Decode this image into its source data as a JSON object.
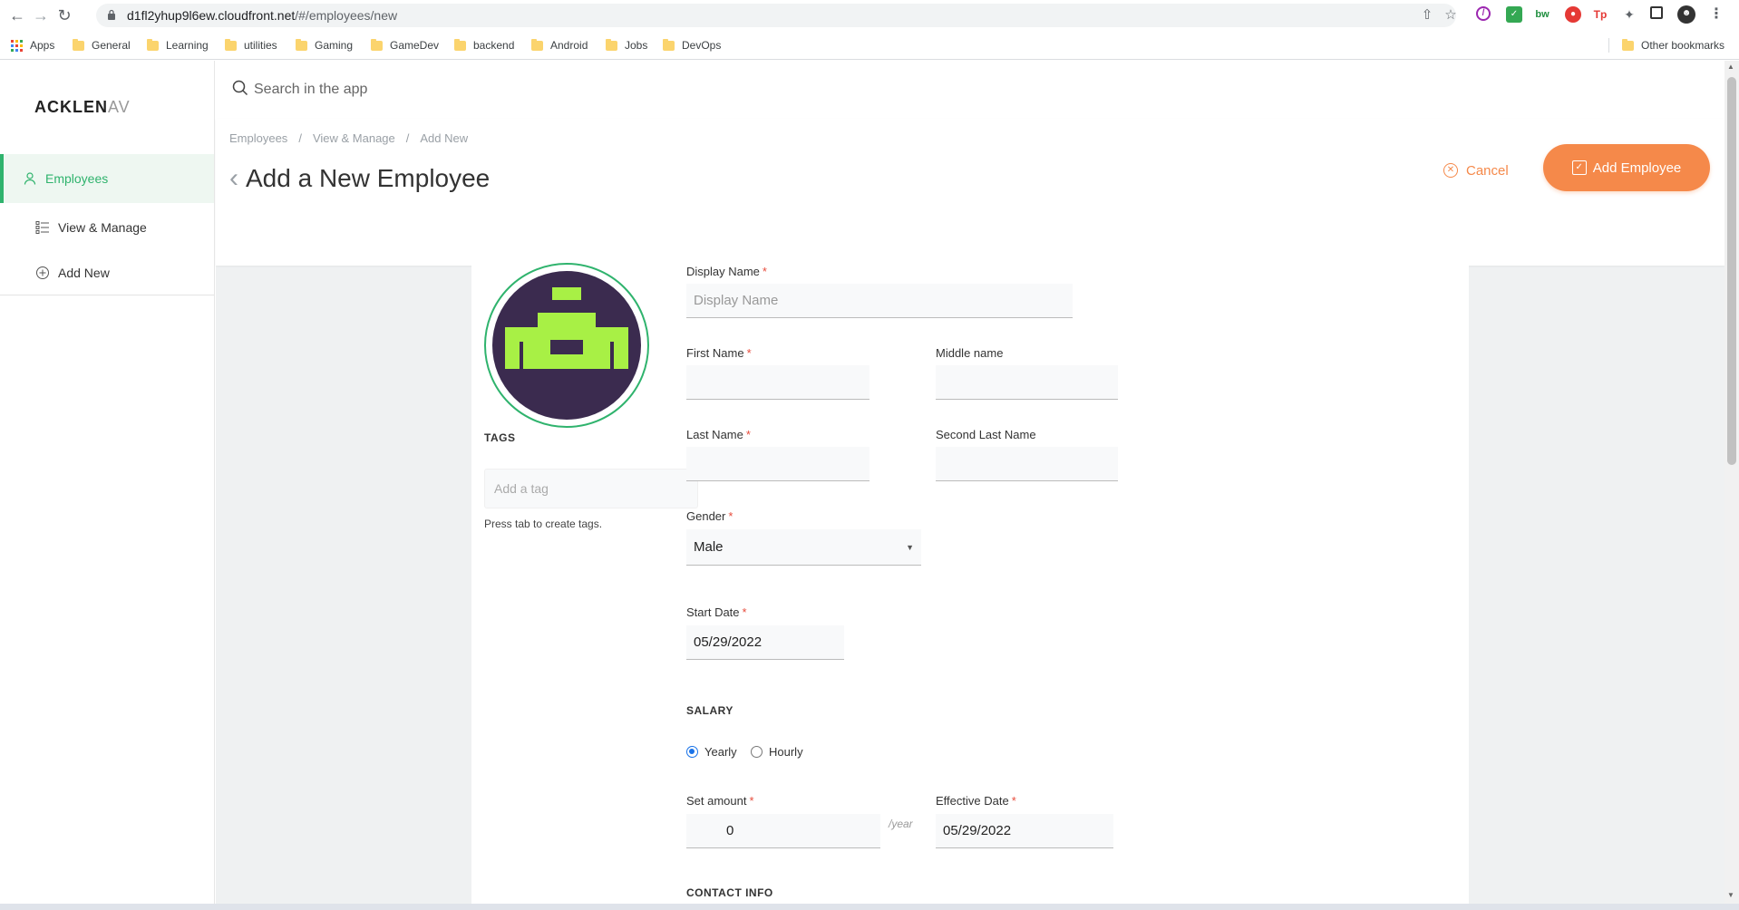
{
  "browser": {
    "url_host": "d1fl2yhup9l6ew.cloudfront.net",
    "url_path": "/#/employees/new",
    "bookmarks": [
      "Apps",
      "General",
      "Learning",
      "utilities",
      "Gaming",
      "GameDev",
      "backend",
      "Android",
      "Jobs",
      "DevOps"
    ],
    "other_bookmarks": "Other bookmarks"
  },
  "app": {
    "logo_main": "ACKLEN",
    "logo_fade": "AV",
    "search_placeholder": "Search in the app"
  },
  "sidebar": {
    "items": [
      {
        "label": "Employees",
        "icon": "user-icon",
        "active": true
      },
      {
        "label": "View & Manage",
        "icon": "list-icon"
      },
      {
        "label": "Add New",
        "icon": "plus-circle-icon"
      }
    ]
  },
  "header": {
    "breadcrumb": [
      "Employees",
      "View & Manage",
      "Add New"
    ],
    "breadcrumb_sep": "/",
    "title": "Add a New Employee",
    "cancel_label": "Cancel",
    "add_label": "Add Employee",
    "accent": "#f5894a",
    "brand_green": "#2fb36d"
  },
  "form": {
    "tags": {
      "label": "TAGS",
      "placeholder": "Add a tag",
      "hint": "Press tab to create tags."
    },
    "display_name": {
      "label": "Display Name",
      "placeholder": "Display Name",
      "value": ""
    },
    "first_name": {
      "label": "First Name",
      "value": ""
    },
    "middle_name": {
      "label": "Middle name",
      "value": ""
    },
    "last_name": {
      "label": "Last Name",
      "value": ""
    },
    "second_last_name": {
      "label": "Second Last Name",
      "value": ""
    },
    "gender": {
      "label": "Gender",
      "value": "Male"
    },
    "start_date": {
      "label": "Start Date",
      "value": "05/29/2022"
    },
    "salary": {
      "section": "SALARY",
      "options": [
        "Yearly",
        "Hourly"
      ],
      "selected": "Yearly",
      "amount_label": "Set amount",
      "currency": "$",
      "amount": "0",
      "unit": "/year",
      "effective_label": "Effective Date",
      "effective_date": "05/29/2022"
    },
    "contact_section": "CONTACT INFO",
    "required_mark": "*"
  }
}
